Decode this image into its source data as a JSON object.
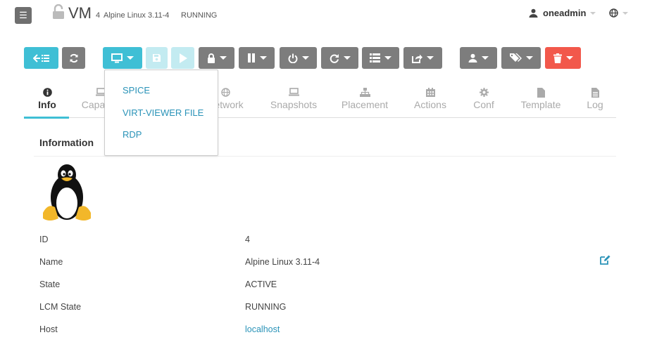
{
  "header": {
    "menu_icon": "hamburger-icon",
    "lock_icon": "lock-open-icon",
    "title": "VM",
    "vm_id": "4",
    "vm_name": "Alpine Linux 3.11-4",
    "vm_state": "RUNNING",
    "user": "oneadmin",
    "user_icon": "user-icon",
    "globe_icon": "globe-icon"
  },
  "toolbar": {
    "back_icon": "back-list-icon",
    "refresh_icon": "refresh-icon",
    "console_icon": "monitor-icon",
    "save_icon": "save-icon",
    "play_icon": "play-icon",
    "lock_icon": "lock-icon",
    "pause_icon": "pause-icon",
    "power_icon": "power-icon",
    "reboot_icon": "redo-icon",
    "list_icon": "list-icon",
    "share_icon": "share-icon",
    "owner_icon": "user-icon",
    "tag_icon": "tags-icon",
    "delete_icon": "trash-icon"
  },
  "console_menu": {
    "items": [
      "SPICE",
      "VIRT-VIEWER FILE",
      "RDP"
    ]
  },
  "tabs": [
    {
      "label": "Info",
      "icon": "info-circle-icon"
    },
    {
      "label": "Capacity",
      "icon": "laptop-icon"
    },
    {
      "label": "Network",
      "icon": "globe-icon"
    },
    {
      "label": "Snapshots",
      "icon": "laptop-icon"
    },
    {
      "label": "Placement",
      "icon": "sitemap-icon"
    },
    {
      "label": "Actions",
      "icon": "calendar-icon"
    },
    {
      "label": "Conf",
      "icon": "gear-icon"
    },
    {
      "label": "Template",
      "icon": "file-icon"
    },
    {
      "label": "Log",
      "icon": "file-text-icon"
    }
  ],
  "info": {
    "heading": "Information",
    "image": "tux-penguin-logo",
    "rows": [
      {
        "label": "ID",
        "value": "4"
      },
      {
        "label": "Name",
        "value": "Alpine Linux 3.11-4"
      },
      {
        "label": "State",
        "value": "ACTIVE"
      },
      {
        "label": "LCM State",
        "value": "RUNNING"
      },
      {
        "label": "Host",
        "value": "localhost"
      }
    ],
    "edit_icon": "edit-icon"
  },
  "colors": {
    "accent": "#3fbfd5",
    "link": "#2a93b8",
    "button_gray": "#7d7d7d",
    "danger": "#f2584b"
  }
}
